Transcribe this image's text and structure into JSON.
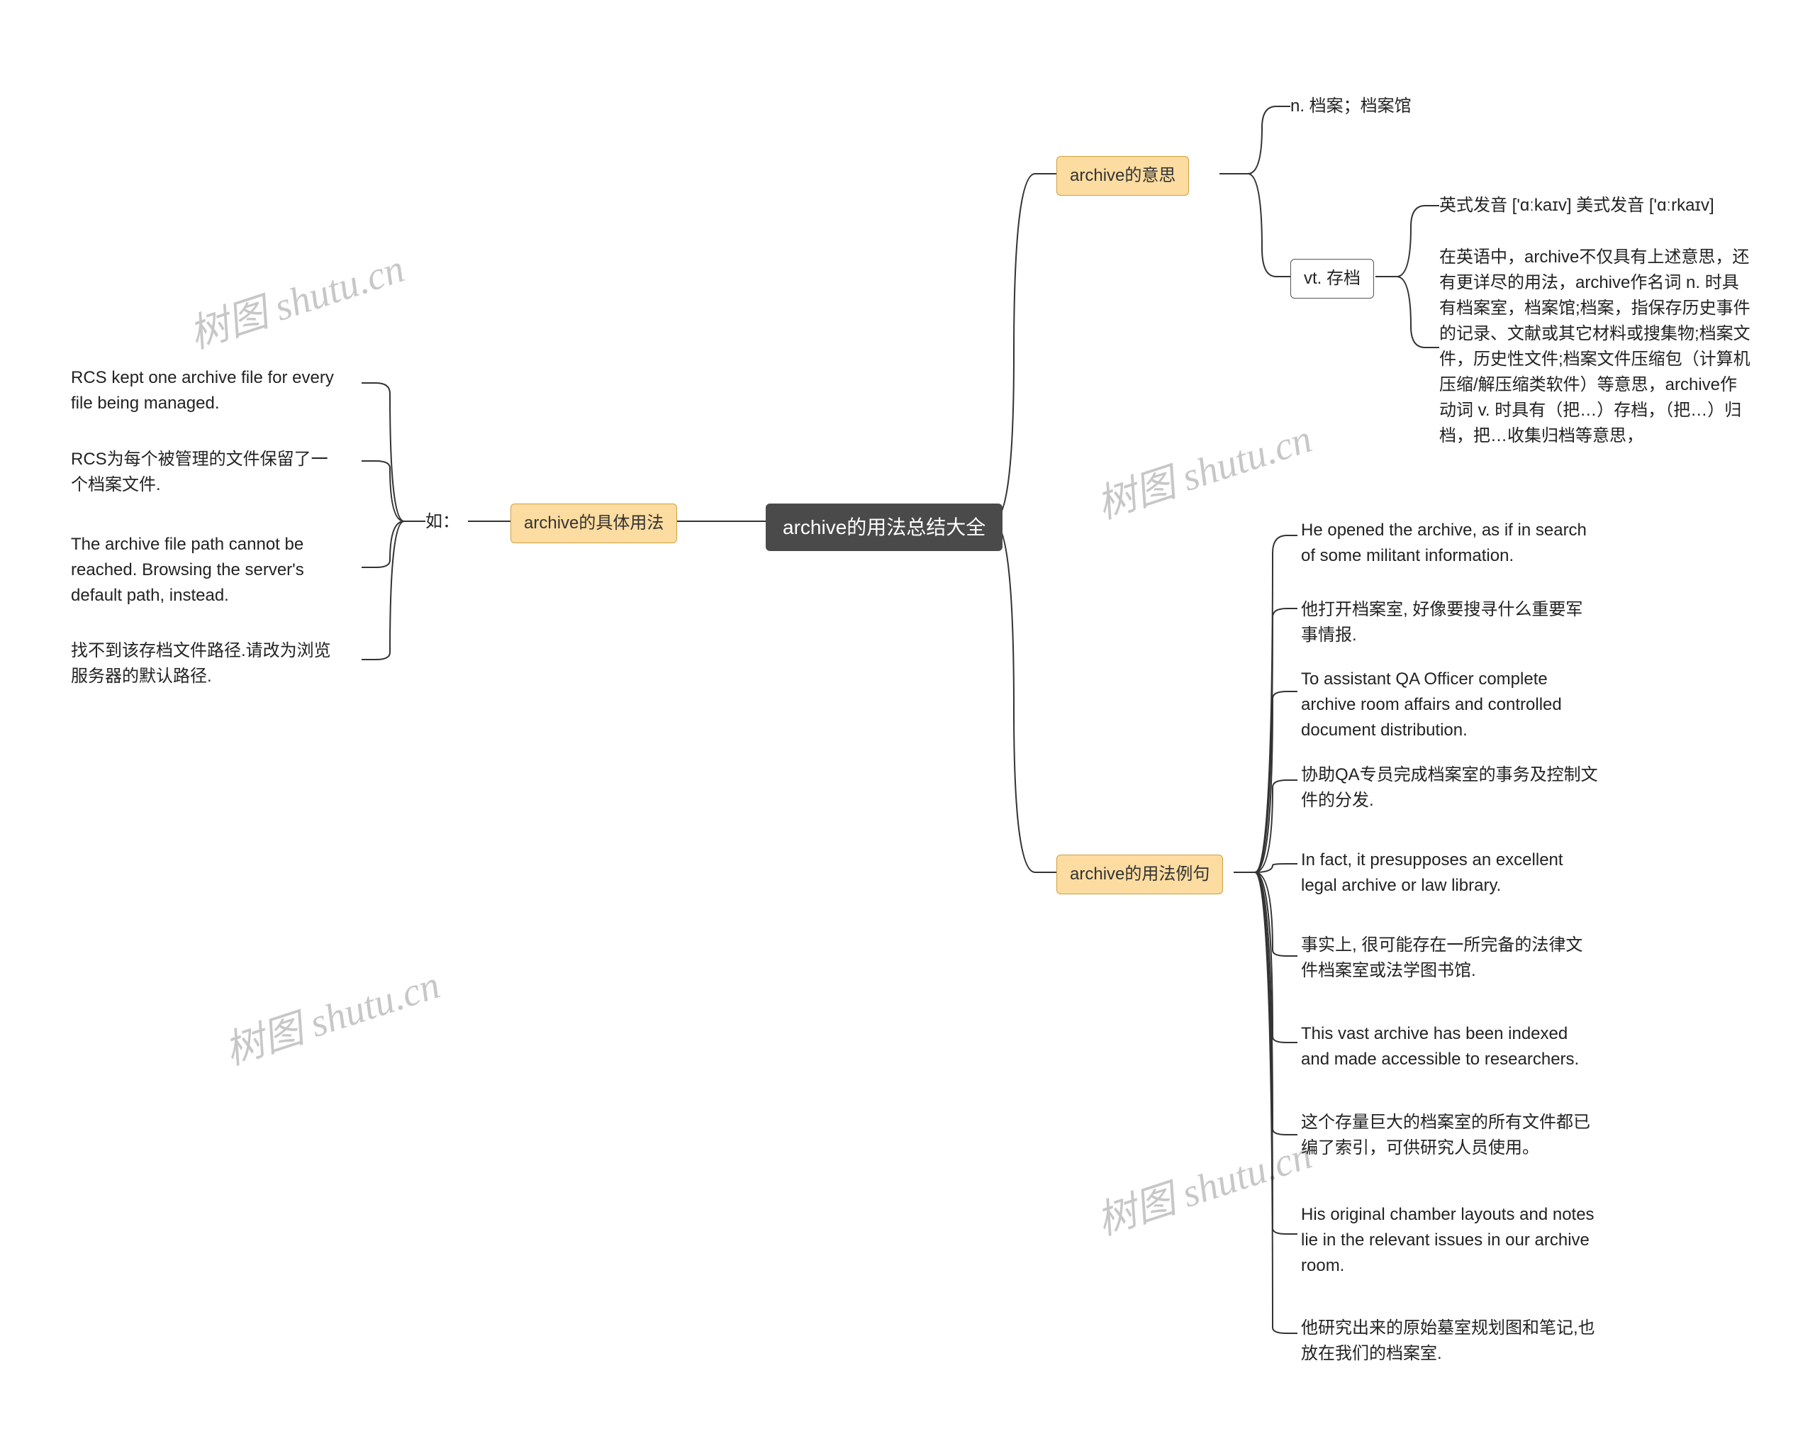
{
  "watermark": "树图 shutu.cn",
  "root": {
    "label": "archive的用法总结大全"
  },
  "branches": {
    "meaning": {
      "label": "archive的意思",
      "noun": "n. 档案；档案馆",
      "verb": {
        "label": "vt. 存档",
        "pron": "英式发音 ['ɑːkaɪv] 美式发音 ['ɑːrkaɪv]",
        "explain": "在英语中，archive不仅具有上述意思，还有更详尽的用法，archive作名词 n. 时具有档案室，档案馆;档案，指保存历史事件的记录、文献或其它材料或搜集物;档案文件，历史性文件;档案文件压缩包（计算机压缩/解压缩类软件）等意思，archive作动词 v. 时具有（把…）存档，（把…）归档，把…收集归档等意思，"
      }
    },
    "usage": {
      "label": "archive的具体用法",
      "intro": "如：",
      "examples": [
        "RCS kept one archive file for every file being managed.",
        "RCS为每个被管理的文件保留了一个档案文件.",
        "The archive file path cannot be reached. Browsing the server's default path, instead.",
        "找不到该存档文件路径.请改为浏览服务器的默认路径."
      ]
    },
    "sentences": {
      "label": "archive的用法例句",
      "items": [
        "He opened the archive, as if in search of some militant information.",
        "他打开档案室, 好像要搜寻什么重要军事情报.",
        "To assistant QA Officer complete archive room affairs and controlled document distribution.",
        "协助QA专员完成档案室的事务及控制文件的分发.",
        "In fact, it presupposes an excellent legal archive or law library.",
        "事实上, 很可能存在一所完备的法律文件档案室或法学图书馆.",
        "This vast archive has been indexed and made accessible to researchers.",
        "这个存量巨大的档案室的所有文件都已编了索引，可供研究人员使用。",
        "His original chamber layouts and notes lie in the relevant issues in our archive room.",
        "他研究出来的原始墓室规划图和笔记,也放在我们的档案室."
      ]
    }
  }
}
